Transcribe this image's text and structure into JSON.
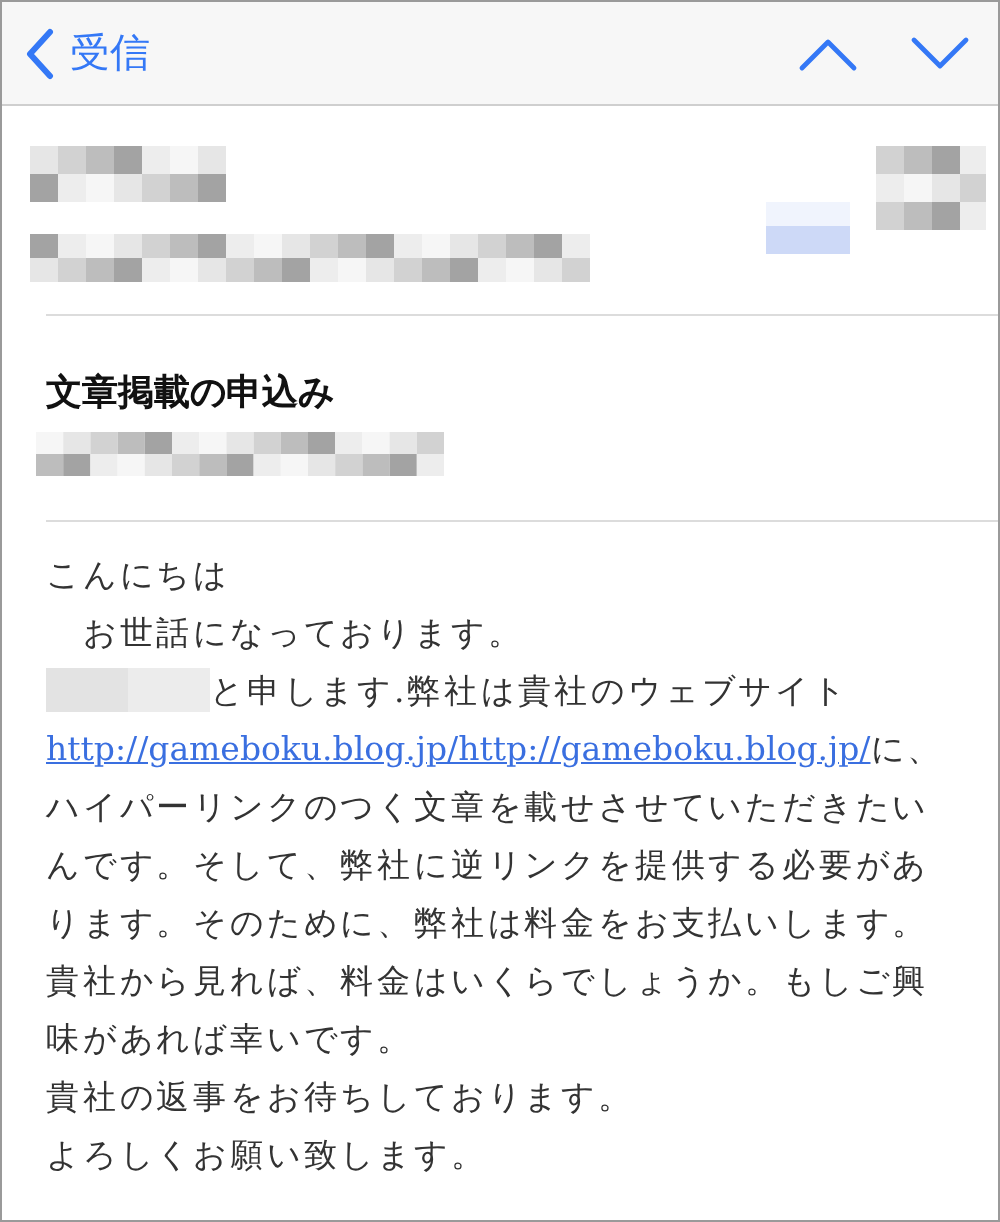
{
  "nav": {
    "back_label": "受信"
  },
  "subject": "文章掲載の申込み",
  "body": [
    {
      "kind": "text",
      "text": "こんにちは"
    },
    {
      "kind": "text",
      "text": "　お世話になっております。"
    },
    {
      "kind": "mixed",
      "redacted": true,
      "before": "と申します.弊社は貴社のウェブサイト ",
      "link": "http://gameboku.blog.jp/http://gameboku.blog.jp/",
      "after": "に、ハイパーリンクのつく文章を載せさせていただきたいんです。そして、弊社に逆リンクを提供する必要があります。そのために、弊社は料金をお支払いします。貴社から見れば、料金はいくらでしょうか。もしご興味があれば幸いです。"
    },
    {
      "kind": "text",
      "text": "貴社の返事をお待ちしております。"
    },
    {
      "kind": "text",
      "text": "よろしくお願い致します。"
    }
  ]
}
